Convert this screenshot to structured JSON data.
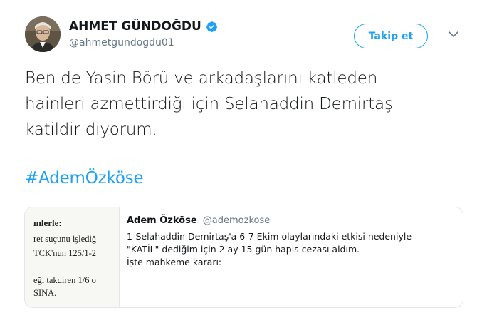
{
  "tweet": {
    "author_name": "AHMET GÜNDOĞDU",
    "handle": "@ahmetgundogdu01",
    "follow_label": "Takip et",
    "text_lines": [
      "Ben de Yasin Börü ve arkadaşlarını katleden",
      "hainleri azmettirdiği için Selahaddin Demirtaş",
      "katildir diyorum."
    ],
    "hashtag": "#AdemÖzköse",
    "colors": {
      "accent": "#1da1f2",
      "secondary_text": "#657786",
      "border": "#e1e8ed"
    }
  },
  "quoted": {
    "author_name": "Adem Özköse",
    "handle": "@ademozkose",
    "text_lines": [
      "1-Selahaddin Demirtaş'a 6-7 Ekim olaylarındaki etkisi nedeniyle",
      "\"KATİL\" dediğim için 2 ay 15 gün hapis cezası aldım.",
      "İşte mahkeme kararı:"
    ],
    "thumbnail_lines": [
      "ınlerle:",
      "ret suçunu işlediğ",
      "TCK'nun 125/1-2",
      "eği takdiren 1/6 o",
      "SINA."
    ]
  },
  "icons": {
    "verified": "verified-badge-icon",
    "more": "chevron-down-icon",
    "avatar": "profile-photo"
  }
}
